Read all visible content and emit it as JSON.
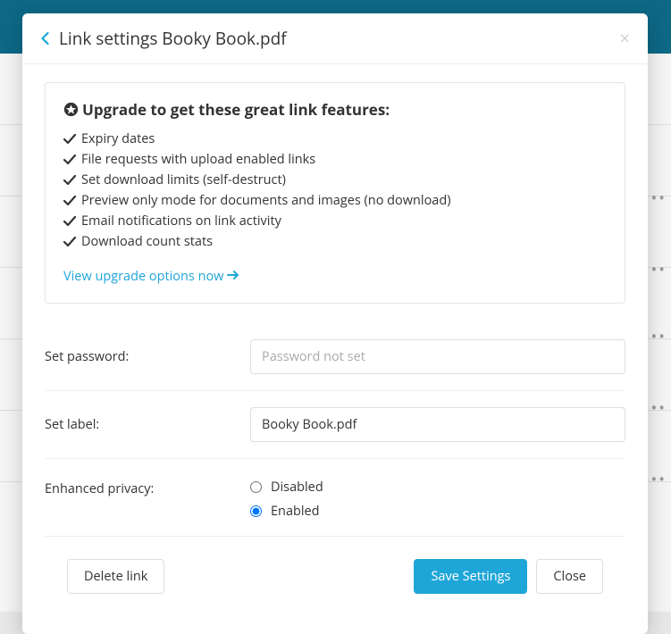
{
  "modal": {
    "title": "Link settings Booky Book.pdf"
  },
  "upgrade": {
    "heading": "Upgrade to get these great link features:",
    "features": [
      "Expiry dates",
      "File requests with upload enabled links",
      "Set download limits (self-destruct)",
      "Preview only mode for documents and images (no download)",
      "Email notifications on link activity",
      "Download count stats"
    ],
    "cta": "View upgrade options now"
  },
  "form": {
    "password_label": "Set password:",
    "password_placeholder": "Password not set",
    "label_label": "Set label:",
    "label_value": "Booky Book.pdf",
    "privacy_label": "Enhanced privacy:",
    "privacy_disabled": "Disabled",
    "privacy_enabled": "Enabled"
  },
  "footer": {
    "delete": "Delete link",
    "save": "Save Settings",
    "close": "Close"
  }
}
